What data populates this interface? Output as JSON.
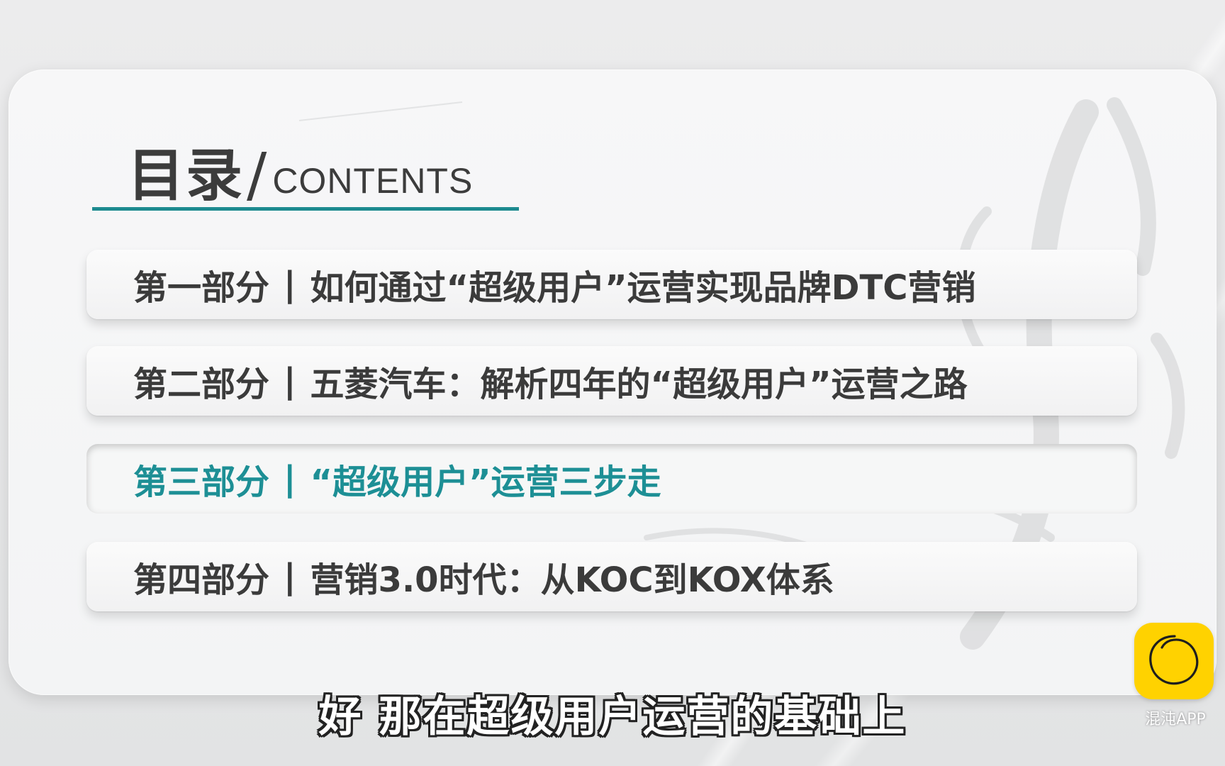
{
  "toc": {
    "title_cn": "目录",
    "title_slash": "/",
    "title_en": "CONTENTS",
    "items": [
      {
        "part": "第一部分",
        "separator": "|",
        "text": "如何通过“超级用户”运营实现品牌DTC营销",
        "active": false
      },
      {
        "part": "第二部分",
        "separator": "|",
        "text": "五菱汽车：解析四年的“超级用户”运营之路",
        "active": false
      },
      {
        "part": "第三部分",
        "separator": "|",
        "text": "“超级用户”运营三步走",
        "active": true
      },
      {
        "part": "第四部分",
        "separator": "|",
        "text": "营销3.0时代：从KOC到KOX体系",
        "active": false
      }
    ]
  },
  "subtitle": "好 那在超级用户运营的基础上",
  "watermark": {
    "icon": "circle-logo-icon",
    "label": "混沌APP"
  },
  "colors": {
    "accent": "#1d8f95",
    "text": "#3b3b3b",
    "logo_bg": "#ffd200"
  }
}
